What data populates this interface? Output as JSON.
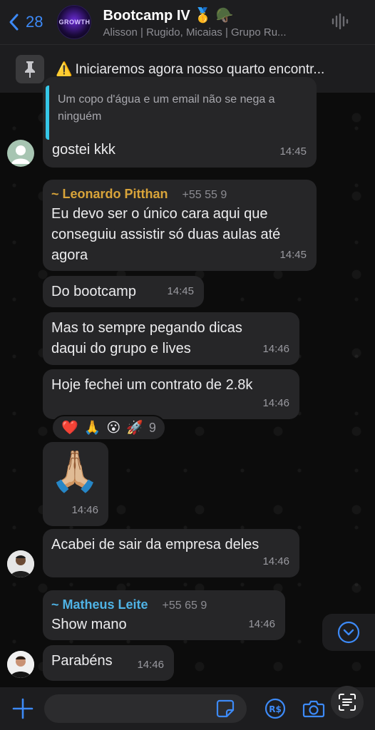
{
  "header": {
    "back_count": "28",
    "title": "Bootcamp IV 🥇 🪖",
    "subtitle": "Alisson | Rugido, Micaias | Grupo Ru...",
    "avatar_text": "GROWTH"
  },
  "pinned": {
    "text": "Iniciaremos agora nosso quarto encontr..."
  },
  "messages": [
    {
      "id": "m1",
      "quote": "Um copo d'água e um email não se nega a ninguém",
      "text": "gostei kkk",
      "time": "14:45"
    },
    {
      "id": "m2",
      "sender": "~ Leonardo Pitthan",
      "phone": "+55 55 9",
      "sender_color": "#d9a43a",
      "text": "Eu devo ser o único cara aqui que conseguiu assistir só duas aulas até agora",
      "time": "14:45"
    },
    {
      "id": "m3",
      "text": "Do bootcamp",
      "time": "14:45"
    },
    {
      "id": "m4",
      "text": "Mas to sempre pegando dicas daqui do grupo e lives",
      "time": "14:46"
    },
    {
      "id": "m5",
      "text": "Hoje fechei um contrato de 2.8k",
      "time": "14:46"
    },
    {
      "id": "m6",
      "emoji": "🙏🏼",
      "time": "14:46"
    },
    {
      "id": "m7",
      "text": "Acabei de sair da empresa deles",
      "time": "14:46"
    },
    {
      "id": "m8",
      "sender": "~ Matheus Leite",
      "phone": "+55 65 9",
      "sender_color": "#4fb3e6",
      "text": "Show mano",
      "time": "14:46"
    },
    {
      "id": "m9",
      "text": "Parabéns",
      "time": "14:46"
    }
  ],
  "reactions": {
    "emojis": [
      "❤️",
      "🙏",
      "😮",
      "🚀"
    ],
    "count": "9"
  },
  "composer": {
    "placeholder": ""
  },
  "colors": {
    "accent": "#3d8af7",
    "bubble": "#262628",
    "quote_bar": "#35c7e8"
  }
}
